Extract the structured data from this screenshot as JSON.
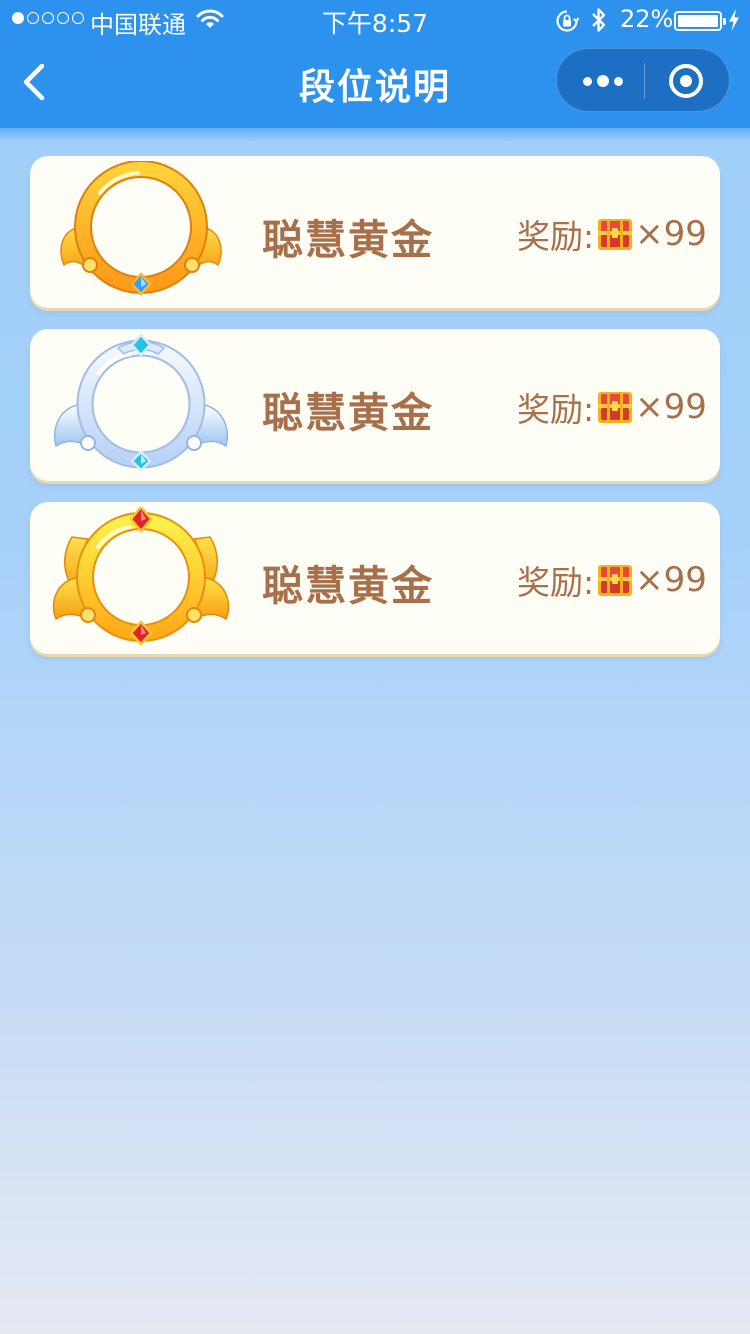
{
  "status_bar": {
    "carrier": "中国联通",
    "time": "下午8:57",
    "battery_percent": "22%",
    "signal_strength": 1,
    "icons": [
      "wifi-icon",
      "orientation-lock-icon",
      "bluetooth-icon",
      "battery-icon",
      "charging-icon"
    ]
  },
  "nav": {
    "title": "段位说明",
    "back_icon": "chevron-left-icon",
    "more_icon": "more-dots-icon",
    "close_icon": "target-circle-icon"
  },
  "colors": {
    "nav_blue": "#2d92ee",
    "card_bg": "#fefdf6",
    "text_brown": "#a8704a",
    "gold": "#ffc21a",
    "silver": "#cfe1fb"
  },
  "ranks": [
    {
      "name": "聪慧黄金",
      "reward_label": "奖励:",
      "reward_count": "×99",
      "badge": "gold-ring-badge-icon"
    },
    {
      "name": "聪慧黄金",
      "reward_label": "奖励:",
      "reward_count": "×99",
      "badge": "silver-ring-badge-icon"
    },
    {
      "name": "聪慧黄金",
      "reward_label": "奖励:",
      "reward_count": "×99",
      "badge": "gold-crown-ring-badge-icon"
    }
  ]
}
